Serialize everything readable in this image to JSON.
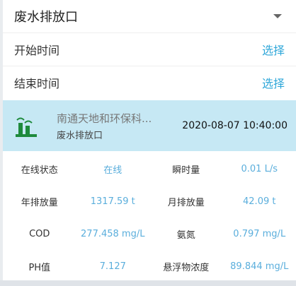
{
  "dropdown": {
    "title": "废水排放口",
    "caret_icon": "caret-down-icon"
  },
  "start_time": {
    "label": "开始时间",
    "action": "选择"
  },
  "end_time": {
    "label": "结束时间",
    "action": "选择"
  },
  "station": {
    "icon": "factory-icon",
    "name": "南通天地和环保科...",
    "subtitle": "废水排放口",
    "timestamp": "2020-08-07 10:40:00"
  },
  "metrics": [
    {
      "k1": "在线状态",
      "v1": "在线",
      "k2": "瞬时量",
      "v2": "0.01 L/s"
    },
    {
      "k1": "年排放量",
      "v1": "1317.59 t",
      "k2": "月排放量",
      "v2": "42.09 t"
    },
    {
      "k1": "COD",
      "v1": "277.458 mg/L",
      "k2": "氨氮",
      "v2": "0.797 mg/L"
    },
    {
      "k1": "PH值",
      "v1": "7.127",
      "k2": "悬浮物浓度",
      "v2": "89.844 mg/L"
    }
  ],
  "colors": {
    "accent": "#2fa7d9",
    "value": "#5aaedc",
    "station_bg": "#c6e8f4",
    "icon_green": "#1e8a3c"
  }
}
